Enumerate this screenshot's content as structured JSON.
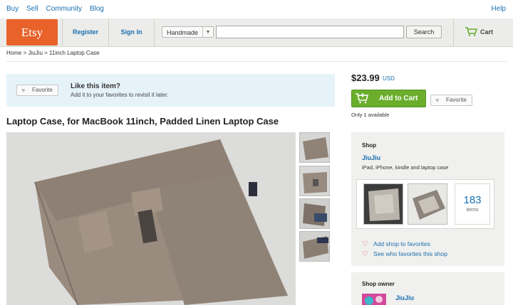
{
  "topnav": {
    "buy": "Buy",
    "sell": "Sell",
    "community": "Community",
    "blog": "Blog",
    "help": "Help"
  },
  "header": {
    "logo": "Etsy",
    "register": "Register",
    "signin": "Sign In",
    "category": "Handmade",
    "search_value": "",
    "search_button": "Search",
    "cart": "Cart"
  },
  "breadcrumb": "Home > JiuJiu > 11inch Laptop Case",
  "like_box": {
    "favorite": "Favorite",
    "title": "Like this item?",
    "subtitle": "Add it to your favorites to revisit it later."
  },
  "item": {
    "title": "Laptop Case, for MacBook 11inch, Padded Linen Laptop Case",
    "price": "$23.99",
    "currency": "USD",
    "add_to_cart": "Add to Cart",
    "favorite": "Favorite",
    "availability": "Only 1 available"
  },
  "shop": {
    "heading": "Shop",
    "name": "JiuJiu",
    "description": "iPad, iPhone, kindle and laptop case",
    "item_count": "183",
    "items_label": "items",
    "add_fav": "Add shop to favorites",
    "who_fav": "See who favorites this shop"
  },
  "owner": {
    "heading": "Shop owner",
    "name": "JiuJiu"
  },
  "colors": {
    "etsy_orange": "#e8622a",
    "link_blue": "#1a6fb0",
    "cart_green": "#6aae2c",
    "like_bg": "#e5f3f9"
  }
}
